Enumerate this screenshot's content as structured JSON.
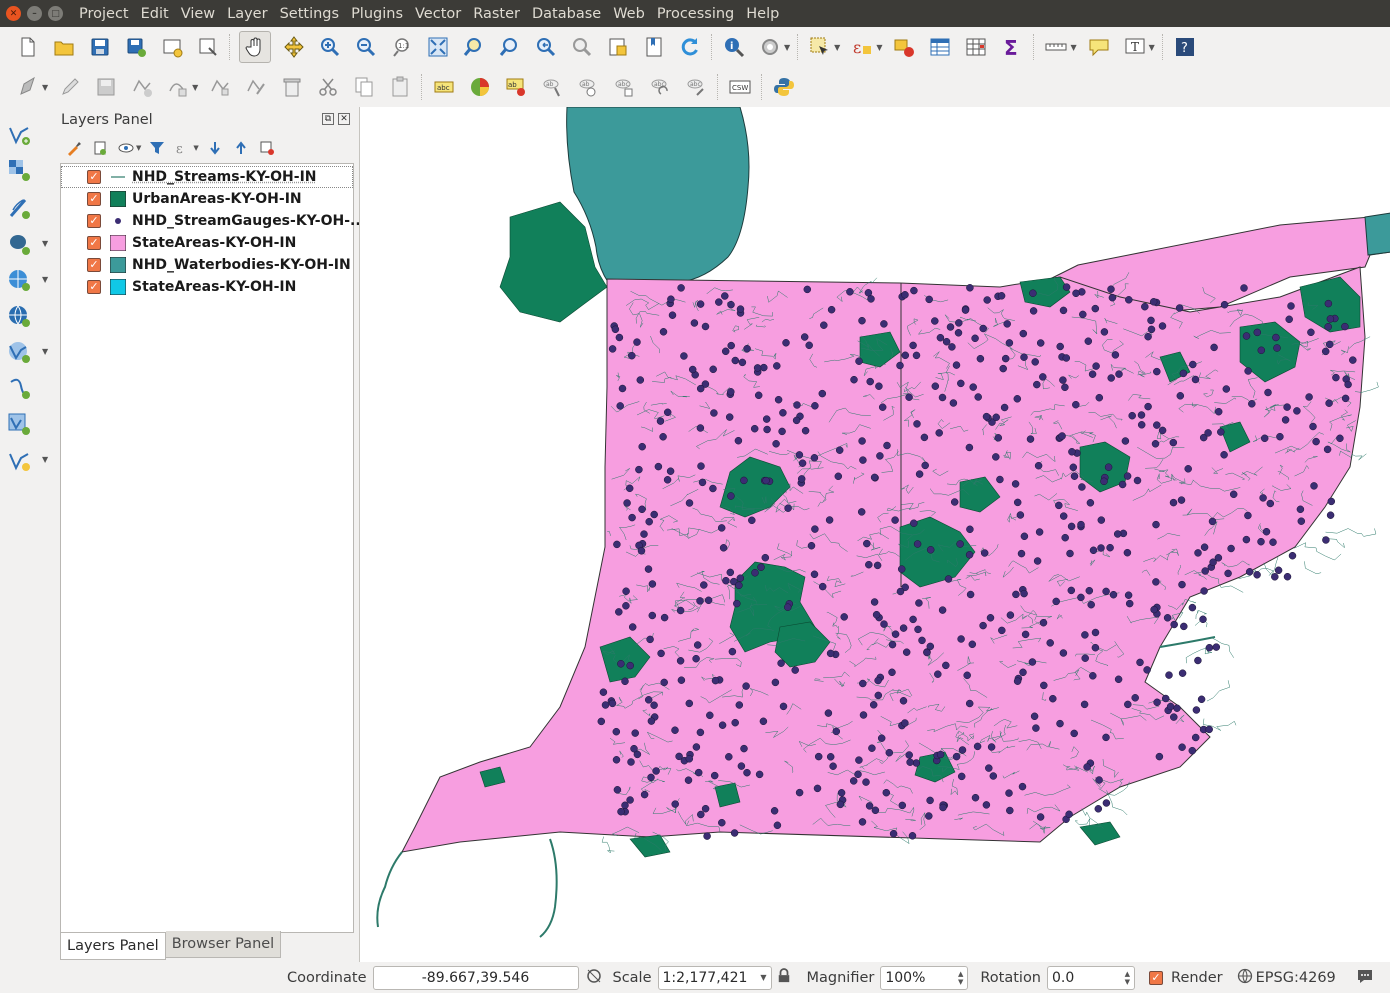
{
  "window": {
    "menu": [
      "Project",
      "Edit",
      "View",
      "Layer",
      "Settings",
      "Plugins",
      "Vector",
      "Raster",
      "Database",
      "Web",
      "Processing",
      "Help"
    ]
  },
  "layers_panel": {
    "title": "Layers Panel",
    "layers": [
      {
        "name": "NHD_Streams-KY-OH-IN",
        "symbol": "line",
        "color": "#2d7a6a",
        "checked": true,
        "selected": true
      },
      {
        "name": "UrbanAreas-KY-OH-IN",
        "symbol": "fill",
        "color": "#11805a",
        "checked": true
      },
      {
        "name": "NHD_StreamGauges-KY-OH-...",
        "symbol": "point",
        "color": "#3b2d73",
        "checked": true
      },
      {
        "name": "StateAreas-KY-OH-IN",
        "symbol": "fill",
        "color": "#f79ee0",
        "checked": true
      },
      {
        "name": "NHD_Waterbodies-KY-OH-IN",
        "symbol": "fill",
        "color": "#3c9a9a",
        "checked": true
      },
      {
        "name": "StateAreas-KY-OH-IN",
        "symbol": "fill",
        "color": "#10c8e6",
        "checked": true
      }
    ],
    "tabs": [
      "Layers Panel",
      "Browser Panel"
    ]
  },
  "statusbar": {
    "coordinate_label": "Coordinate",
    "coordinate_value": "-89.667,39.546",
    "scale_label": "Scale",
    "scale_value": "1:2,177,421",
    "magnifier_label": "Magnifier",
    "magnifier_value": "100%",
    "rotation_label": "Rotation",
    "rotation_value": "0.0",
    "render_label": "Render",
    "crs_label": "EPSG:4269"
  },
  "map_colors": {
    "state_fill": "#f79ee0",
    "urban_fill": "#11805a",
    "water_fill": "#3c9a9a",
    "stream": "#2d7a6a",
    "gauge": "#3b2d73"
  }
}
